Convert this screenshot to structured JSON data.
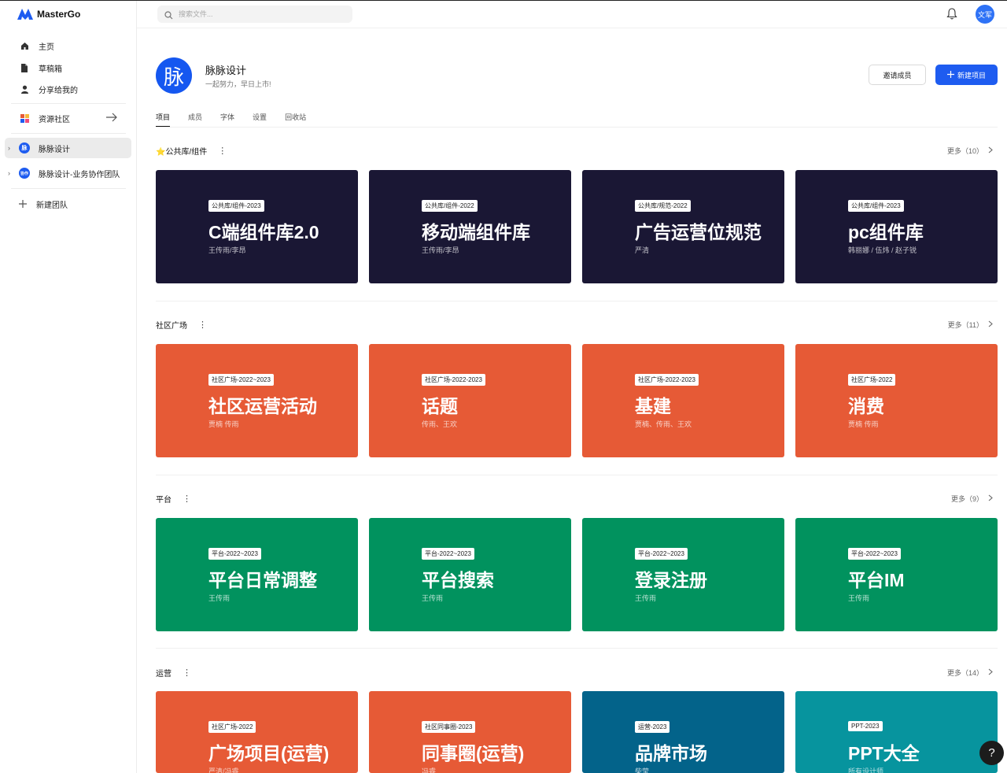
{
  "app": {
    "name": "MasterGo"
  },
  "sidebar": {
    "items": [
      {
        "label": "主页",
        "icon": "home-icon"
      },
      {
        "label": "草稿箱",
        "icon": "draft-icon"
      },
      {
        "label": "分享给我的",
        "icon": "user-icon"
      }
    ],
    "community": {
      "label": "资源社区",
      "icon": "community-icon"
    },
    "teams": [
      {
        "label": "脉脉设计",
        "badge": "脉",
        "active": true
      },
      {
        "label": "脉脉设计-业务协作团队",
        "badge": "协作",
        "active": false
      }
    ],
    "new_team": "新建团队"
  },
  "topbar": {
    "search_placeholder": "搜索文件...",
    "avatar_text": "文军"
  },
  "team": {
    "logo_text": "脉",
    "name": "脉脉设计",
    "desc": "一起努力，早日上市!",
    "invite_label": "邀请成员",
    "new_project_label": "新建项目"
  },
  "tabs": [
    "项目",
    "成员",
    "字体",
    "设置",
    "回收站"
  ],
  "colors": {
    "navy": "#1a1734",
    "orange": "#e65a36",
    "green": "#01925e",
    "teal_dark": "#03638a",
    "teal": "#07949e",
    "accent": "#1e5cf0"
  },
  "sections": [
    {
      "title": "⭐公共库/组件",
      "more": "更多（10）",
      "cards": [
        {
          "tag": "公共库/组件-2023",
          "title": "C端组件库2.0",
          "sub": "王传雨/李昂",
          "color": "#1a1734"
        },
        {
          "tag": "公共库/组件-2022",
          "title": "移动端组件库",
          "sub": "王传雨/李昂",
          "color": "#1a1734"
        },
        {
          "tag": "公共库/规范-2022",
          "title": "广告运营位规范",
          "sub": "严清",
          "color": "#1a1734"
        },
        {
          "tag": "公共库/组件-2023",
          "title": "pc组件库",
          "sub": "韩丽娜 / 伍炜 / 赵子锐",
          "color": "#1a1734"
        }
      ]
    },
    {
      "title": "社区广场",
      "more": "更多（11）",
      "cards": [
        {
          "tag": "社区广场-2022~2023",
          "title": "社区运营活动",
          "sub": "贾楠 传雨",
          "color": "#e65a36"
        },
        {
          "tag": "社区广场-2022-2023",
          "title": "话题",
          "sub": "传雨、王欢",
          "color": "#e65a36"
        },
        {
          "tag": "社区广场-2022-2023",
          "title": "基建",
          "sub": "贾楠、传雨、王欢",
          "color": "#e65a36"
        },
        {
          "tag": "社区广场-2022",
          "title": "消费",
          "sub": "贾楠 传雨",
          "color": "#e65a36"
        }
      ]
    },
    {
      "title": "平台",
      "more": "更多（9）",
      "cards": [
        {
          "tag": "平台-2022~2023",
          "title": "平台日常调整",
          "sub": "王传雨",
          "color": "#01925e"
        },
        {
          "tag": "平台-2022~2023",
          "title": "平台搜索",
          "sub": "王传雨",
          "color": "#01925e"
        },
        {
          "tag": "平台-2022~2023",
          "title": "登录注册",
          "sub": "王传雨",
          "color": "#01925e"
        },
        {
          "tag": "平台-2022~2023",
          "title": "平台IM",
          "sub": "王传雨",
          "color": "#01925e"
        }
      ]
    },
    {
      "title": "运营",
      "more": "更多（14）",
      "cards": [
        {
          "tag": "社区广场-2022",
          "title": "广场项目(运营)",
          "sub": "严清/冯睿",
          "color": "#e65a36"
        },
        {
          "tag": "社区同事圈-2023",
          "title": "同事圈(运营)",
          "sub": "冯睿",
          "color": "#e65a36"
        },
        {
          "tag": "运营-2023",
          "title": "品牌市场",
          "sub": "柴莹",
          "color": "#03638a"
        },
        {
          "tag": "PPT-2023",
          "title": "PPT大全",
          "sub": "所有设计师",
          "color": "#07949e"
        }
      ]
    }
  ],
  "help": "?"
}
